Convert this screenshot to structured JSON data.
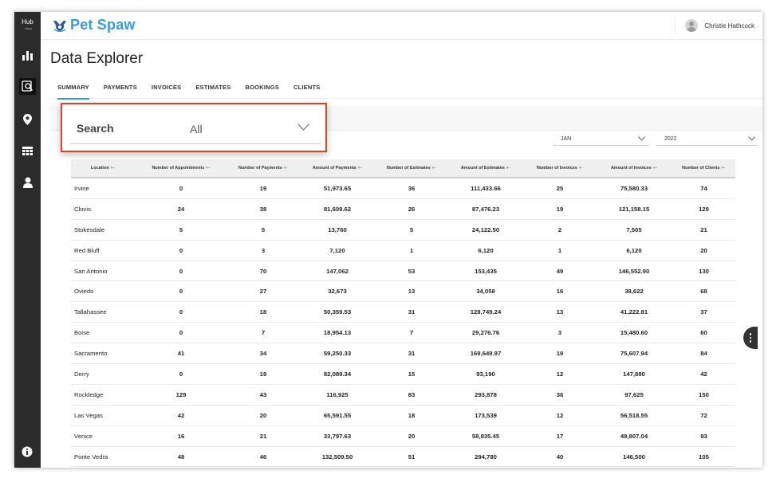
{
  "sidebar": {
    "logo": "Hub",
    "logo_sub": "- keyo",
    "items": [
      {
        "icon": "bar-chart-icon"
      },
      {
        "icon": "data-explorer-icon"
      },
      {
        "icon": "location-pin-icon"
      },
      {
        "icon": "table-icon"
      },
      {
        "icon": "user-icon"
      }
    ],
    "bottom_icon": "info-icon"
  },
  "header": {
    "brand": "Pet Spaw",
    "user_name": "Christie Hathcock"
  },
  "page_title": "Data Explorer",
  "tabs": [
    {
      "label": "SUMMARY",
      "active": true
    },
    {
      "label": "PAYMENTS"
    },
    {
      "label": "INVOICES"
    },
    {
      "label": "ESTIMATES"
    },
    {
      "label": "BOOKINGS"
    },
    {
      "label": "CLIENTS"
    }
  ],
  "search": {
    "label": "Search",
    "value": "All"
  },
  "filters": {
    "month": "JAN",
    "year": "2022"
  },
  "table": {
    "columns": [
      "Location",
      "Number of Appointments",
      "Number of Payments",
      "Amount of Payments",
      "Number of Estimates",
      "Amount of Estimates",
      "Number of Invoices",
      "Amount of Invoices",
      "Number of Clients"
    ],
    "rows": [
      [
        "Irvine",
        "0",
        "19",
        "51,973.65",
        "36",
        "111,433.66",
        "25",
        "75,580.33",
        "74"
      ],
      [
        "Clovis",
        "24",
        "38",
        "81,609.62",
        "26",
        "87,476.23",
        "19",
        "121,158.15",
        "129"
      ],
      [
        "Stokesdale",
        "5",
        "5",
        "13,760",
        "5",
        "24,122.50",
        "2",
        "7,505",
        "21"
      ],
      [
        "Red Bluff",
        "0",
        "3",
        "7,120",
        "1",
        "6,120",
        "1",
        "6,120",
        "20"
      ],
      [
        "San Antonio",
        "0",
        "70",
        "147,062",
        "53",
        "153,435",
        "49",
        "146,552.90",
        "130"
      ],
      [
        "Oviedo",
        "0",
        "27",
        "32,673",
        "13",
        "34,058",
        "16",
        "38,622",
        "68"
      ],
      [
        "Tallahassee",
        "0",
        "18",
        "50,359.53",
        "31",
        "128,749.24",
        "13",
        "41,222.81",
        "37"
      ],
      [
        "Boise",
        "0",
        "7",
        "18,954.13",
        "7",
        "29,276.76",
        "3",
        "15,480.60",
        "60"
      ],
      [
        "Sacramento",
        "41",
        "34",
        "59,250.33",
        "31",
        "169,649.97",
        "19",
        "75,607.94",
        "84"
      ],
      [
        "Derry",
        "0",
        "19",
        "82,089.34",
        "15",
        "93,190",
        "12",
        "147,880",
        "42"
      ],
      [
        "Rockledge",
        "129",
        "43",
        "116,925",
        "83",
        "293,878",
        "36",
        "97,625",
        "150"
      ],
      [
        "Las Vegas",
        "42",
        "20",
        "65,591.55",
        "18",
        "173,539",
        "12",
        "56,518.55",
        "72"
      ],
      [
        "Venice",
        "16",
        "21",
        "33,797.63",
        "20",
        "58,835.45",
        "17",
        "49,807.04",
        "93"
      ],
      [
        "Ponte Vedra",
        "48",
        "46",
        "132,509.50",
        "51",
        "294,780",
        "40",
        "146,500",
        "105"
      ]
    ]
  }
}
